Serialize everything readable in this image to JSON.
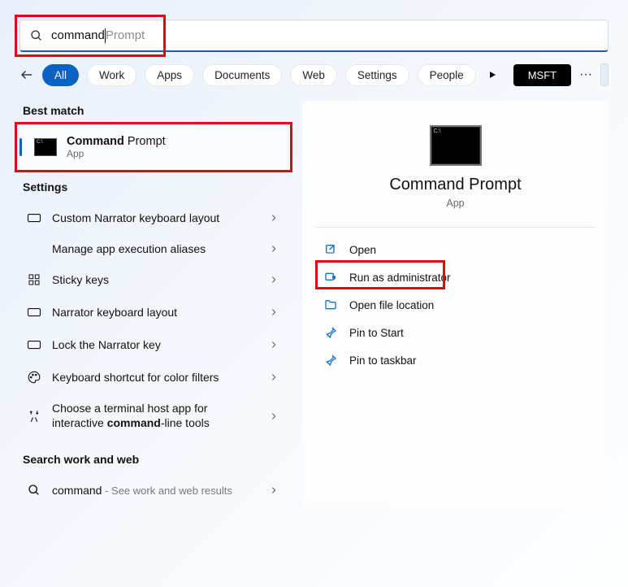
{
  "search": {
    "typed": "command",
    "suggestion": " Prompt"
  },
  "filters": {
    "items": [
      "All",
      "Work",
      "Apps",
      "Documents",
      "Web",
      "Settings",
      "People"
    ],
    "active": "All"
  },
  "account_btn": "MSFT",
  "left": {
    "best_match_label": "Best match",
    "best_item": {
      "title_bold": "Command",
      "title_rest": " Prompt",
      "subtitle": "App"
    },
    "settings_label": "Settings",
    "settings_items": [
      {
        "text_before": "Custom Narrator keyboard layout",
        "bold": "",
        "text_after": "",
        "icon": "keyboard"
      },
      {
        "text_before": "Manage app execution aliases",
        "bold": "",
        "text_after": "",
        "icon": ""
      },
      {
        "text_before": "Sticky keys",
        "bold": "",
        "text_after": "",
        "icon": "grid"
      },
      {
        "text_before": "Narrator keyboard layout",
        "bold": "",
        "text_after": "",
        "icon": "keyboard"
      },
      {
        "text_before": "Lock the Narrator key",
        "bold": "",
        "text_after": "",
        "icon": "keyboard"
      },
      {
        "text_before": "Keyboard shortcut for color filters",
        "bold": "",
        "text_after": "",
        "icon": "palette"
      },
      {
        "text_before": "Choose a terminal host app for interactive ",
        "bold": "command",
        "text_after": "-line tools",
        "icon": "tools"
      }
    ],
    "work_web_label": "Search work and web",
    "work_item": {
      "prefix": "command",
      "suffix": " - See work and web results"
    }
  },
  "right": {
    "app_title": "Command Prompt",
    "app_sub": "App",
    "actions": [
      {
        "label": "Open",
        "icon": "open"
      },
      {
        "label": "Run as administrator",
        "icon": "admin"
      },
      {
        "label": "Open file location",
        "icon": "folder"
      },
      {
        "label": "Pin to Start",
        "icon": "pin"
      },
      {
        "label": "Pin to taskbar",
        "icon": "pin"
      }
    ]
  }
}
